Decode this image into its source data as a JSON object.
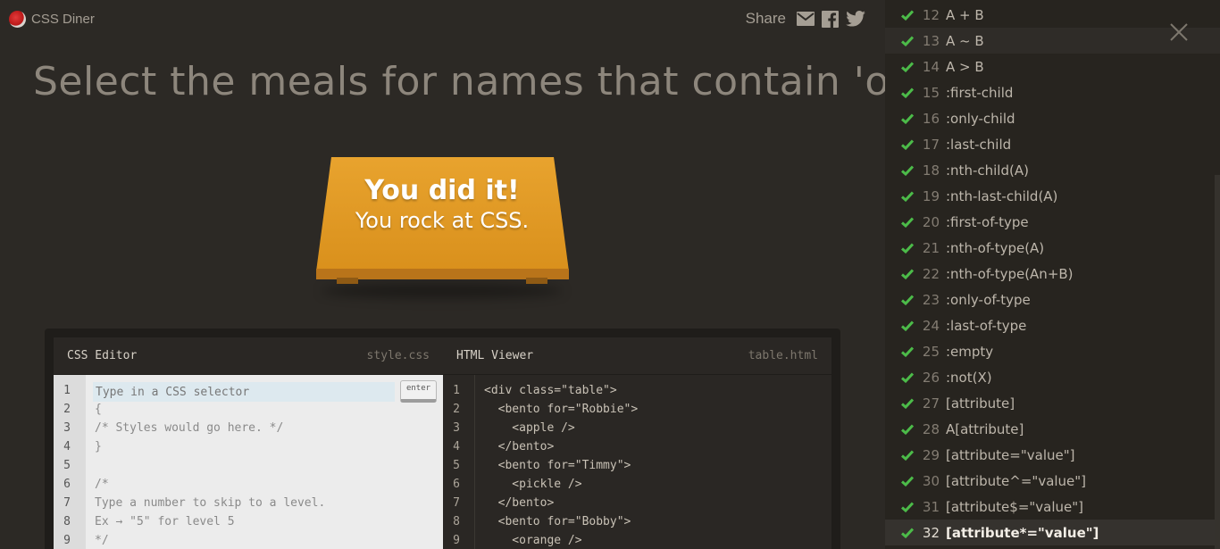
{
  "app": {
    "name": "CSS Diner",
    "share_label": "Share"
  },
  "instruction": "Select the meals for names that contain 'obb'",
  "banner": {
    "line1": "You did it!",
    "line2": "You rock at CSS."
  },
  "css_editor": {
    "title": "CSS Editor",
    "file": "style.css",
    "placeholder": "Type in a CSS selector",
    "enter_label": "enter",
    "line_numbers": [
      "1",
      "2",
      "3",
      "4",
      "5",
      "6",
      "7",
      "8",
      "9"
    ],
    "lines": [
      "",
      "{",
      "/* Styles would go here. */",
      "}",
      "",
      "/*",
      "Type a number to skip to a level.",
      "Ex → \"5\" for level 5",
      "*/"
    ]
  },
  "html_viewer": {
    "title": "HTML Viewer",
    "file": "table.html",
    "line_numbers": [
      "1",
      "2",
      "3",
      "4",
      "5",
      "6",
      "7",
      "8",
      "9"
    ],
    "lines": [
      "<div class=\"table\">",
      "  <bento for=\"Robbie\">",
      "    <apple />",
      "  </bento>",
      "  <bento for=\"Timmy\">",
      "    <pickle />",
      "  </bento>",
      "  <bento for=\"Bobby\">",
      "    <orange />"
    ]
  },
  "levels": [
    {
      "num": "12",
      "name": "A + B",
      "done": true
    },
    {
      "num": "13",
      "name": "A ~ B",
      "done": true,
      "hover": true
    },
    {
      "num": "14",
      "name": "A > B",
      "done": true
    },
    {
      "num": "15",
      "name": ":first-child",
      "done": true
    },
    {
      "num": "16",
      "name": ":only-child",
      "done": true
    },
    {
      "num": "17",
      "name": ":last-child",
      "done": true
    },
    {
      "num": "18",
      "name": ":nth-child(A)",
      "done": true
    },
    {
      "num": "19",
      "name": ":nth-last-child(A)",
      "done": true
    },
    {
      "num": "20",
      "name": ":first-of-type",
      "done": true
    },
    {
      "num": "21",
      "name": ":nth-of-type(A)",
      "done": true
    },
    {
      "num": "22",
      "name": ":nth-of-type(An+B)",
      "done": true
    },
    {
      "num": "23",
      "name": ":only-of-type",
      "done": true
    },
    {
      "num": "24",
      "name": ":last-of-type",
      "done": true
    },
    {
      "num": "25",
      "name": ":empty",
      "done": true
    },
    {
      "num": "26",
      "name": ":not(X)",
      "done": true
    },
    {
      "num": "27",
      "name": "[attribute]",
      "done": true
    },
    {
      "num": "28",
      "name": "A[attribute]",
      "done": true
    },
    {
      "num": "29",
      "name": "[attribute=\"value\"]",
      "done": true
    },
    {
      "num": "30",
      "name": "[attribute^=\"value\"]",
      "done": true
    },
    {
      "num": "31",
      "name": "[attribute$=\"value\"]",
      "done": true
    },
    {
      "num": "32",
      "name": "[attribute*=\"value\"]",
      "done": true,
      "current": true
    }
  ],
  "colors": {
    "check": "#4cbb49",
    "table": "#e09a26",
    "background": "#2c2925"
  }
}
